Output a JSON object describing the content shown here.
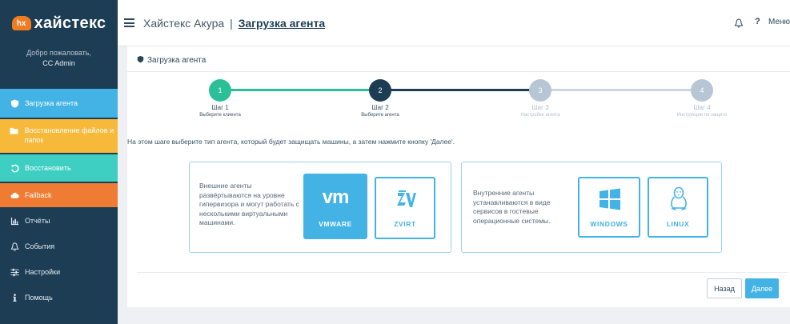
{
  "brand": {
    "mark": "hx",
    "name": "хайстекс"
  },
  "welcome": {
    "greeting": "Добро пожаловать,",
    "user": "CC Admin"
  },
  "sidebar": {
    "items": [
      {
        "label": "Загрузка агента",
        "icon": "shield-icon",
        "color": "#43b3e6"
      },
      {
        "label": "Восстановление файлов и папок",
        "icon": "folder-icon",
        "color": "#f6b93a"
      },
      {
        "label": "Восстановить",
        "icon": "restore-icon",
        "color": "#3ecfc2"
      },
      {
        "label": "Failback",
        "icon": "cloud-icon",
        "color": "#f07c34"
      },
      {
        "label": "Отчёты",
        "icon": "bar-chart-icon"
      },
      {
        "label": "События",
        "icon": "bell-icon"
      },
      {
        "label": "Настройки",
        "icon": "sliders-icon"
      },
      {
        "label": "Помощь",
        "icon": "info-icon"
      }
    ]
  },
  "header": {
    "app": "Хайстекс Акура",
    "separator": "|",
    "current": "Загрузка агента",
    "help": "?",
    "menu": "Меню"
  },
  "breadcrumb": "Загрузка агента",
  "steps": [
    {
      "num": "1",
      "title": "Шаг 1",
      "subtitle": "Выберите клиента",
      "state": "done",
      "color": "#2bbf97"
    },
    {
      "num": "2",
      "title": "Шаг 2",
      "subtitle": "Выберите агента",
      "state": "current",
      "color": "#1d3d54"
    },
    {
      "num": "3",
      "title": "Шаг 3",
      "subtitle": "Настройки агента",
      "state": "pending",
      "color": "#b7c6d4"
    },
    {
      "num": "4",
      "title": "Шаг 4",
      "subtitle": "Инструкции по защите",
      "state": "pending",
      "color": "#b7c6d4"
    }
  ],
  "instruction": "На этом шаге выберите тип агента, который будет защищать машины, а затем нажмите кнопку 'Далее'.",
  "external": {
    "description": "Внешние агенты развёртываются на уровне гипервизора и могут работать с несколькими виртуальными машинами.",
    "tiles": [
      {
        "logo": "vm",
        "label": "VMWARE",
        "selected": true
      },
      {
        "logo": "zvirt-icon",
        "label": "ZVIRT",
        "selected": false
      }
    ]
  },
  "internal": {
    "description": "Внутренние агенты устанавливаются в виде сервисов в гостевые операционные системы.",
    "tiles": [
      {
        "logo": "windows-icon",
        "label": "WINDOWS",
        "selected": false
      },
      {
        "logo": "linux-icon",
        "label": "LINUX",
        "selected": false
      }
    ]
  },
  "buttons": {
    "back": "Назад",
    "next": "Далее"
  },
  "colors": {
    "primary": "#43b3e6",
    "sidebar": "#1d3d54",
    "success": "#2bbf97"
  }
}
